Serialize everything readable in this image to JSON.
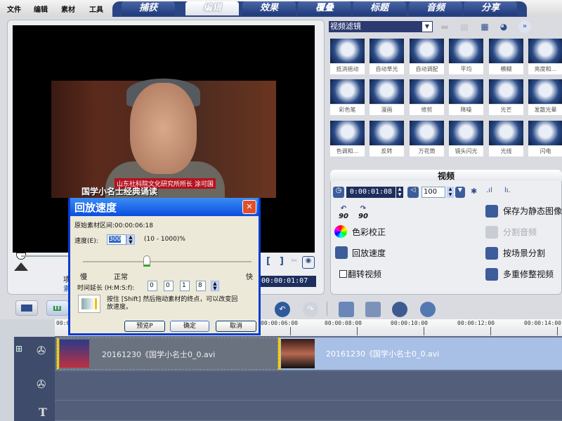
{
  "menu": [
    "文件",
    "编辑",
    "素材",
    "工具"
  ],
  "tabs": [
    {
      "label": "捕获"
    },
    {
      "label": "编辑",
      "active": true
    },
    {
      "label": "效果"
    },
    {
      "label": "覆叠"
    },
    {
      "label": "标题"
    },
    {
      "label": "音频"
    },
    {
      "label": "分享"
    }
  ],
  "preview": {
    "subtitle_red": "山东社科院文化研究所所长 涂可国",
    "subtitle_main": "国学小名士经典诵读",
    "timecode": "00:00:01:07",
    "left_label_1": "项",
    "left_label_2": "素"
  },
  "dialog": {
    "title": "回放速度",
    "original_duration_label": "原始素材区间:00:00:06:18",
    "speed_label": "速度(E):",
    "speed_value": "300",
    "speed_range": "(10 - 1000)%",
    "slow": "慢",
    "normal": "正常",
    "fast": "快",
    "slider_percent": 38,
    "duration_label": "时间延长 (H:M:S:f):",
    "duration": [
      "0",
      "0",
      "1",
      "8"
    ],
    "hint": "按住 [Shift] 然后拖动素材的终点，可以改变回放速度。",
    "preview_btn": "预览P",
    "ok_btn": "确定",
    "cancel_btn": "取消"
  },
  "library": {
    "category": "视频滤镜",
    "filters": [
      "抵消摇动",
      "自动草光",
      "自动调配",
      "平均",
      "模糊",
      "亮度和...",
      "彩色笔",
      "漫画",
      "修剪",
      "降噪",
      "光芒",
      "发散光晕",
      "色调和...",
      "反转",
      "万花筒",
      "镜头闪光",
      "光线",
      "闪电"
    ]
  },
  "options": {
    "title": "视频",
    "duration": "0:00:01:08",
    "volume": "100",
    "rotate_left": "90",
    "rotate_right": "90",
    "color_correction": "色彩校正",
    "playback_speed": "回放速度",
    "reverse_video": "翻转视频",
    "reverse_checked": false,
    "save_still": "保存为静态图像",
    "split_audio": "分割音频",
    "split_by_scene": "按场景分割",
    "multi_trim": "多重修整视频"
  },
  "timeline": {
    "ruler": [
      "00:0",
      "00:00:06:00",
      "00:00:08:00",
      "00:00:10:00",
      "00:00:12:00",
      "00:00:14:00"
    ],
    "clips": [
      {
        "name": "20161230《国学小名士0_0.avi"
      },
      {
        "name": "20161230《国学小名士0_0.avi"
      }
    ],
    "title_track_icon": "T"
  },
  "colors": {
    "tab_blue": "#1f3a78",
    "selected_clip": "#a8c0e6",
    "track": "#535f7a",
    "dialog_title": "#0a4ee0"
  }
}
